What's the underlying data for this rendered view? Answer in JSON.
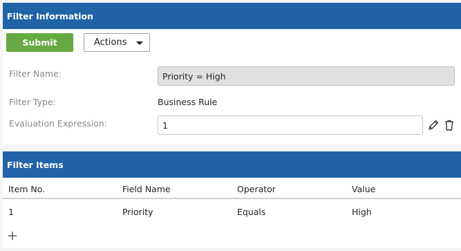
{
  "filter_info": {
    "title": "Filter Information",
    "submit_label": "Submit",
    "actions_label": "Actions",
    "name_label": "Filter Name:",
    "name_value": "Priority = High",
    "type_label": "Filter Type:",
    "type_value": "Business Rule",
    "expression_label": "Evaluation Expression:",
    "expression_value": "1"
  },
  "filter_items": {
    "title": "Filter Items",
    "columns": [
      "Item No.",
      "Field Name",
      "Operator",
      "Value"
    ],
    "rows": [
      [
        "1",
        "Priority",
        "Equals",
        "High"
      ]
    ]
  },
  "colors": {
    "header": "#2063a6",
    "submit": "#66a843"
  },
  "icons": [
    "edit-icon",
    "trash-icon",
    "chevron-down-icon",
    "add-icon"
  ]
}
